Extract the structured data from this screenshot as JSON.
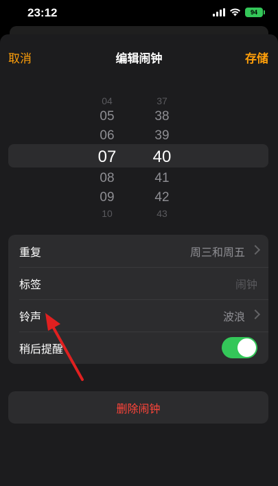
{
  "status_bar": {
    "time": "23:12",
    "battery": "94",
    "icons": [
      "signal-icon",
      "wifi-icon",
      "battery-icon"
    ]
  },
  "nav": {
    "cancel": "取消",
    "title": "编辑闹钟",
    "save": "存储"
  },
  "picker": {
    "hours": [
      "04",
      "05",
      "06",
      "07",
      "08",
      "09",
      "10"
    ],
    "minutes": [
      "37",
      "38",
      "39",
      "40",
      "41",
      "42",
      "43"
    ],
    "selected_hour": "07",
    "selected_minute": "40"
  },
  "settings": {
    "repeat_label": "重复",
    "repeat_value": "周三和周五",
    "label_label": "标签",
    "label_placeholder": "闹钟",
    "sound_label": "铃声",
    "sound_value": "波浪",
    "snooze_label": "稍后提醒",
    "snooze_on": true
  },
  "delete_label": "删除闹钟",
  "colors": {
    "accent": "#ff9f0a",
    "toggle_on": "#34c759",
    "delete": "#ff453a",
    "arrow": "#e02020"
  }
}
